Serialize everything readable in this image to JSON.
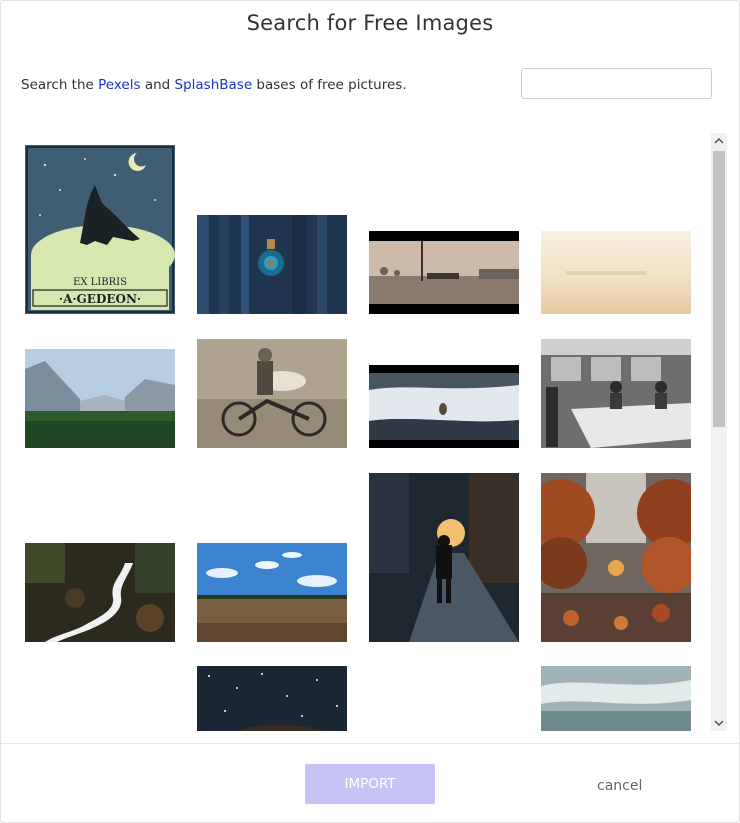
{
  "dialog": {
    "title": "Search for Free Images",
    "intro": {
      "prefix": "Search the ",
      "link1": "Pexels",
      "middle": " and ",
      "link2": "SplashBase",
      "suffix": " bases of free pictures."
    },
    "search": {
      "value": "",
      "placeholder": ""
    },
    "link_color": "#1a33c8"
  },
  "gallery": {
    "images": [
      {
        "name": "ex-libris-gedeon",
        "text_top": "EX LIBRIS",
        "text_bottom": "·A·GEDEON·"
      },
      {
        "name": "blue-wooden-door"
      },
      {
        "name": "bench-by-lake"
      },
      {
        "name": "misty-sunrise"
      },
      {
        "name": "mountain-valley"
      },
      {
        "name": "vintage-motorcycle"
      },
      {
        "name": "bird-on-snow"
      },
      {
        "name": "vintage-workroom"
      },
      {
        "name": "forest-waterfall"
      },
      {
        "name": "field-blue-sky"
      },
      {
        "name": "city-street-sunset"
      },
      {
        "name": "autumn-leaves-path"
      },
      {
        "name": "starry-night-sky"
      },
      {
        "name": "clouds-over-sea"
      }
    ]
  },
  "footer": {
    "import_label": "IMPORT",
    "cancel_label": "cancel",
    "import_color": "#c7c3f7"
  }
}
